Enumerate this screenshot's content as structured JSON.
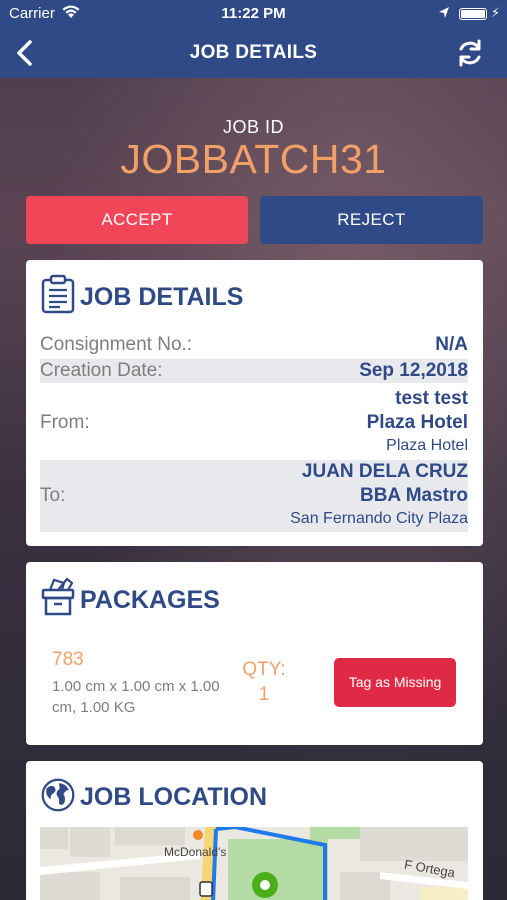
{
  "status_bar": {
    "carrier": "Carrier",
    "time": "11:22 PM"
  },
  "nav": {
    "title": "JOB DETAILS",
    "back_icon": "chevron-left-icon",
    "refresh_icon": "refresh-icon"
  },
  "job": {
    "id_label": "JOB ID",
    "id_value": "JOBBATCH31"
  },
  "actions": {
    "accept_label": "ACCEPT",
    "reject_label": "REJECT"
  },
  "details": {
    "title": "JOB DETAILS",
    "consignment_label": "Consignment No.:",
    "consignment_value": "N/A",
    "creation_label": "Creation Date:",
    "creation_value": "Sep 12,2018",
    "from_label": "From:",
    "from_name": "test test",
    "from_place": "Plaza Hotel",
    "from_address": "Plaza Hotel",
    "to_label": "To:",
    "to_name": "JUAN DELA CRUZ",
    "to_place": "BBA Mastro",
    "to_address": "San Fernando City Plaza"
  },
  "packages": {
    "title": "PACKAGES",
    "items": [
      {
        "id": "783",
        "dimensions": "1.00 cm x 1.00 cm x 1.00 cm, 1.00 KG",
        "qty_label": "QTY:",
        "qty_value": "1",
        "tag_label": "Tag as Missing"
      }
    ]
  },
  "location": {
    "title": "JOB LOCATION",
    "map_labels": {
      "poi": "McDonald's",
      "street": "F Ortega"
    }
  },
  "colors": {
    "primary": "#2f4a86",
    "accent_orange": "#f2a068",
    "accept_red": "#f04658",
    "tag_red": "#e02a45"
  }
}
